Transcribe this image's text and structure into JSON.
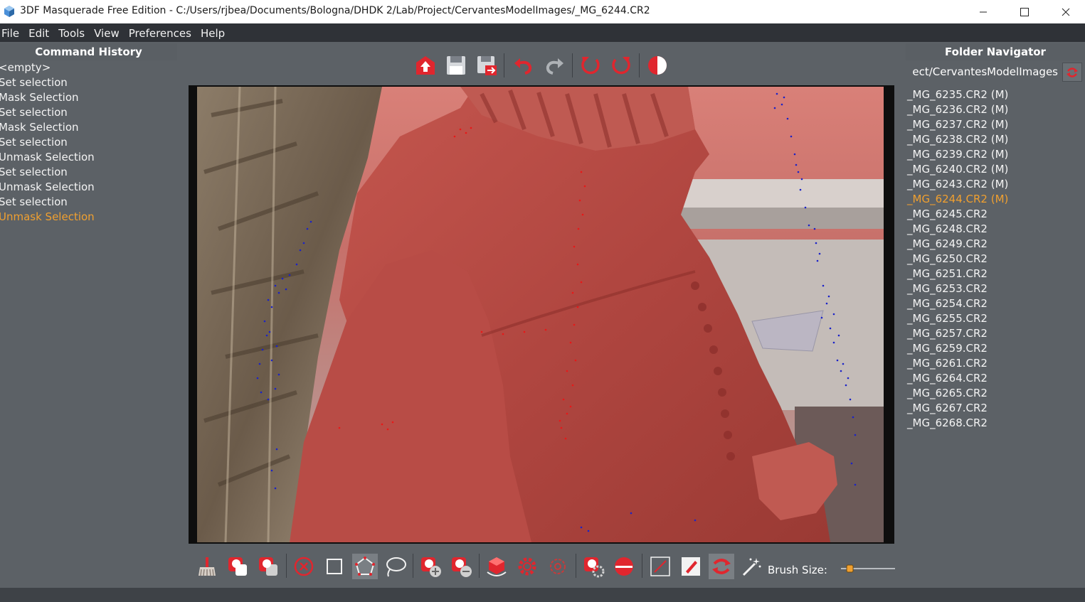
{
  "window": {
    "title": "3DF Masquerade Free Edition - C:/Users/rjbea/Documents/Bologna/DHDK 2/Lab/Project/CervantesModelImages/_MG_6244.CR2",
    "app_icon": "3df-cube-icon",
    "controls": [
      "minimize-icon",
      "maximize-icon",
      "close-icon"
    ]
  },
  "menu": [
    "File",
    "Edit",
    "Tools",
    "View",
    "Preferences",
    "Help"
  ],
  "command_history": {
    "title": "Command History",
    "items": [
      "<empty>",
      "Set selection",
      "Mask Selection",
      "Set selection",
      "Mask Selection",
      "Set selection",
      "Unmask Selection",
      "Set selection",
      "Unmask Selection",
      "Set selection",
      "Unmask Selection"
    ],
    "active_index": 10
  },
  "top_toolbar": {
    "icons": [
      "open-icon",
      "save-icon",
      "save-as-icon",
      "undo-icon",
      "redo-icon",
      "rotate-left-icon",
      "rotate-right-icon",
      "contrast-icon"
    ]
  },
  "bottom_toolbar": {
    "icons": [
      "clear-brush-icon",
      "mask-add-icon",
      "mask-subtract-icon",
      "cancel-icon",
      "rectangle-select-icon",
      "polygon-select-icon",
      "lasso-select-icon",
      "add-selection-icon",
      "remove-selection-icon",
      "3d-mask-icon",
      "settings-red-icon",
      "settings-outline-icon",
      "mask-filter-icon",
      "half-mask-icon",
      "line-tool-icon",
      "brush-tool-icon",
      "swap-icon",
      "magic-wand-icon"
    ],
    "brush_size_label": "Brush Size:",
    "brush_size_level": 0.12
  },
  "folder_navigator": {
    "title": "Folder Navigator",
    "path": "ect/CervantesModelImages",
    "files": [
      "_MG_6235.CR2 (M)",
      "_MG_6236.CR2 (M)",
      "_MG_6237.CR2 (M)",
      "_MG_6238.CR2 (M)",
      "_MG_6239.CR2 (M)",
      "_MG_6240.CR2 (M)",
      "_MG_6243.CR2 (M)",
      "_MG_6244.CR2 (M)",
      "_MG_6245.CR2",
      "_MG_6248.CR2",
      "_MG_6249.CR2",
      "_MG_6250.CR2",
      "_MG_6251.CR2",
      "_MG_6253.CR2",
      "_MG_6254.CR2",
      "_MG_6255.CR2",
      "_MG_6257.CR2",
      "_MG_6259.CR2",
      "_MG_6261.CR2",
      "_MG_6264.CR2",
      "_MG_6265.CR2",
      "_MG_6267.CR2",
      "_MG_6268.CR2"
    ],
    "active_index": 7
  },
  "colors": {
    "accent": "#f0a030",
    "tool_red": "#e0262e",
    "mask_overlay": "#c8443c"
  }
}
